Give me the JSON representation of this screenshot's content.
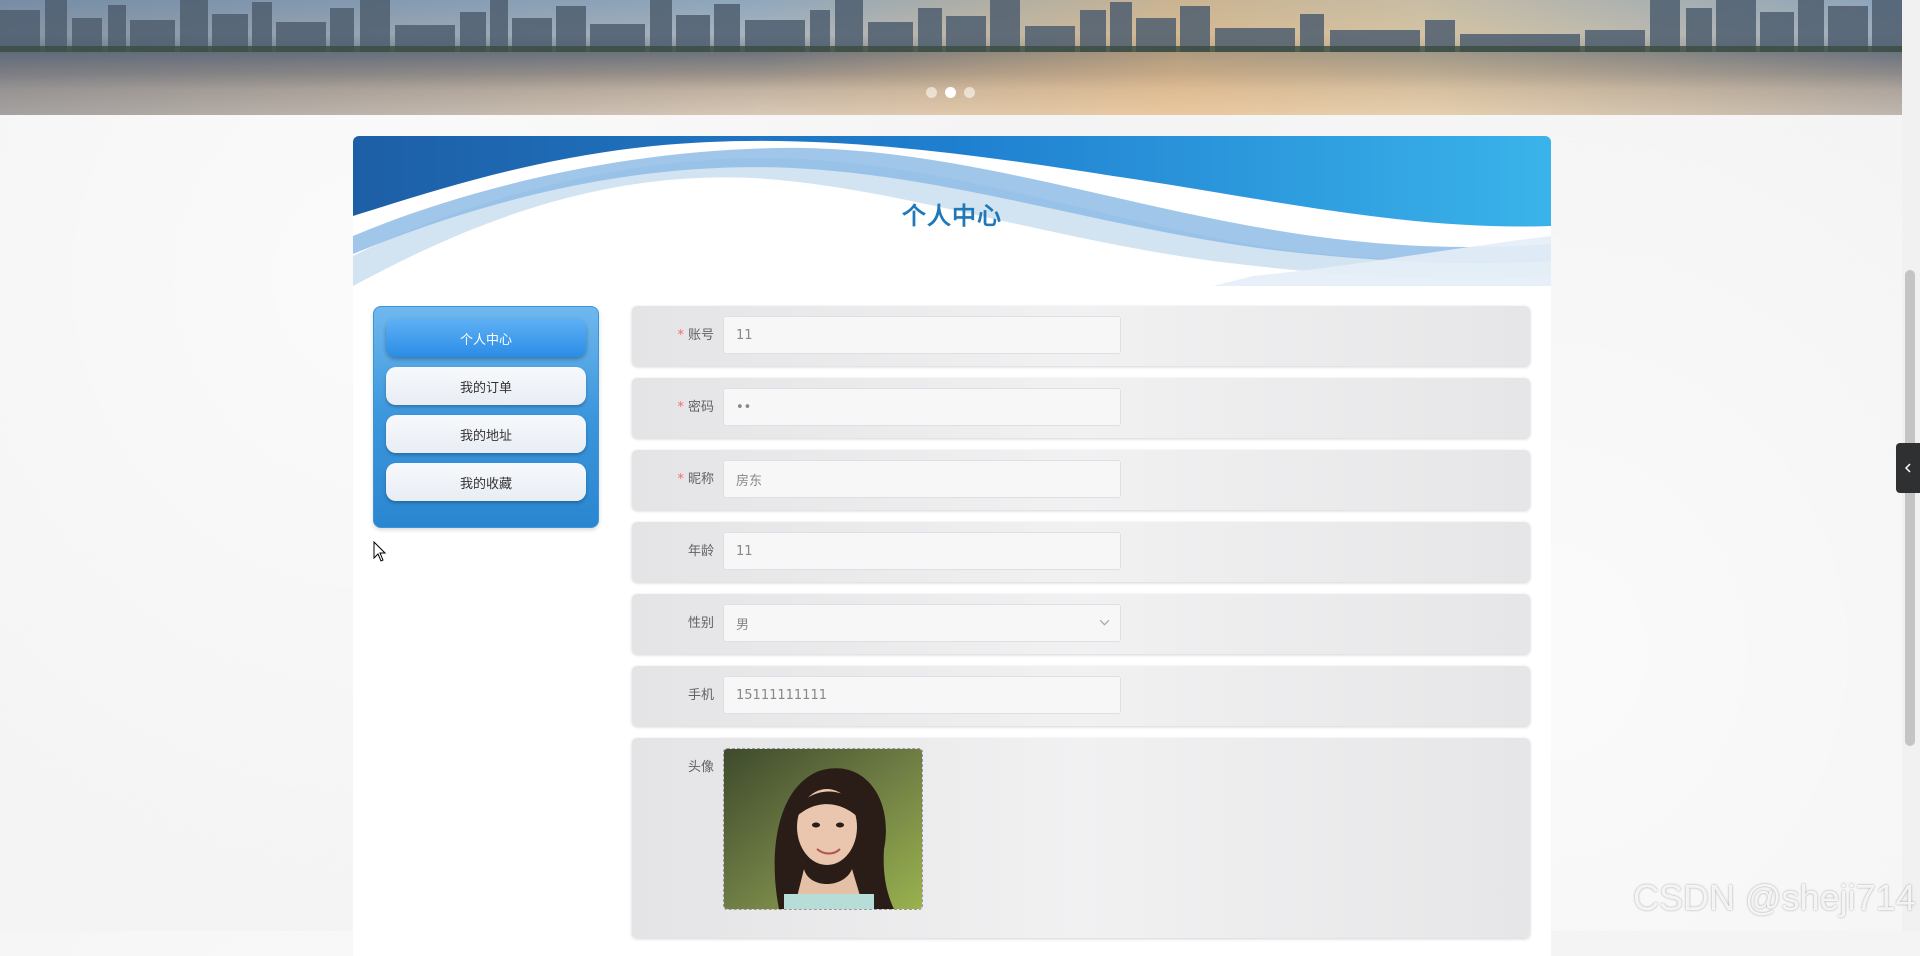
{
  "banner": {
    "slides": 3,
    "active_slide": 2
  },
  "page_title": "个人中心",
  "sidebar": {
    "items": [
      {
        "label": "个人中心",
        "active": true
      },
      {
        "label": "我的订单",
        "active": false
      },
      {
        "label": "我的地址",
        "active": false
      },
      {
        "label": "我的收藏",
        "active": false
      }
    ]
  },
  "form": {
    "account": {
      "label": "账号",
      "required": true,
      "value": "11"
    },
    "password": {
      "label": "密码",
      "required": true,
      "value": "••"
    },
    "nickname": {
      "label": "昵称",
      "required": true,
      "value": "房东"
    },
    "age": {
      "label": "年龄",
      "required": false,
      "value": "11"
    },
    "gender": {
      "label": "性别",
      "required": false,
      "value": "男"
    },
    "phone": {
      "label": "手机",
      "required": false,
      "value": "15111111111"
    },
    "avatar": {
      "label": "头像"
    }
  },
  "required_mark": "*",
  "watermark": "CSDN @sheji714",
  "colors": {
    "primary": "#2b8de6",
    "title": "#1f78b8",
    "required": "#f56c6c"
  }
}
